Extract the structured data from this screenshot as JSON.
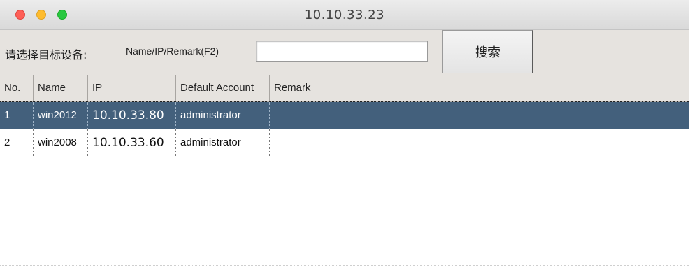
{
  "window": {
    "title": "10.10.33.23"
  },
  "toolbar": {
    "label": "请选择目标设备:",
    "hint": "Name/IP/Remark(F2)",
    "search_value": "",
    "search_button": "搜索"
  },
  "table": {
    "columns": [
      "No.",
      "Name",
      "IP",
      "Default Account",
      "Remark"
    ],
    "rows": [
      {
        "no": "1",
        "name": "win2012",
        "ip": "10.10.33.80",
        "account": "administrator",
        "remark": "",
        "selected": true
      },
      {
        "no": "2",
        "name": "win2008",
        "ip": "10.10.33.60",
        "account": "administrator",
        "remark": "",
        "selected": false
      }
    ]
  },
  "colors": {
    "selection": "#43607c",
    "toolbar_bg": "#e6e3df",
    "close": "#fe5f57",
    "minimize": "#febc2e",
    "zoom": "#28c840"
  }
}
